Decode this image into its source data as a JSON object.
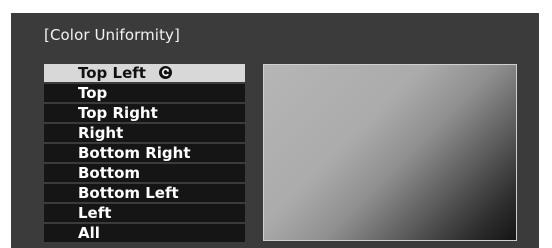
{
  "title": "[Color Uniformity]",
  "menu": {
    "items": [
      {
        "label": "Top Left",
        "selected": true
      },
      {
        "label": "Top"
      },
      {
        "label": "Top Right"
      },
      {
        "label": "Right"
      },
      {
        "label": "Bottom Right"
      },
      {
        "label": "Bottom"
      },
      {
        "label": "Bottom Left"
      },
      {
        "label": "Left"
      },
      {
        "label": "All"
      }
    ],
    "selected_icon": "enter-icon"
  },
  "colors": {
    "panel_bg": "#3b3b3b",
    "item_bg": "#151515",
    "selected_bg": "#d8d8d8"
  }
}
